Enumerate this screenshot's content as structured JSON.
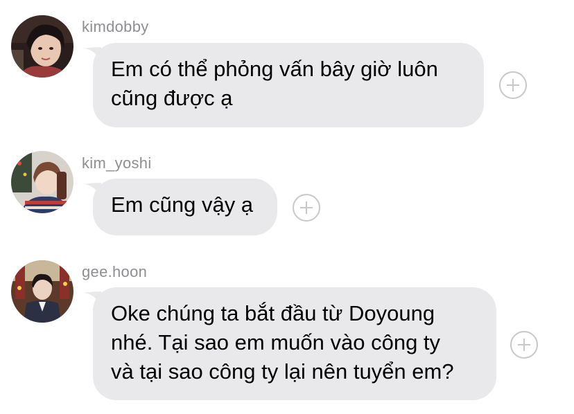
{
  "messages": [
    {
      "username": "kimdobby",
      "text": "Em có thể phỏng vấn bây giờ luôn\ncũng được ạ",
      "avatar_icon": "avatar-photo"
    },
    {
      "username": "kim_yoshi",
      "text": "Em cũng vậy ạ",
      "avatar_icon": "avatar-photo"
    },
    {
      "username": "gee.hoon",
      "text": "Oke chúng ta bắt đầu từ Doyoung\nnhé. Tại sao em muốn vào công ty\nvà tại sao công ty lại nên tuyển em?",
      "avatar_icon": "avatar-photo"
    }
  ],
  "icons": {
    "add_reaction": "plus-icon"
  },
  "colors": {
    "bubble_bg": "#e9e9eb",
    "username_text": "#8e8e93",
    "plus_icon": "#c7c7cc",
    "background": "#ffffff"
  }
}
